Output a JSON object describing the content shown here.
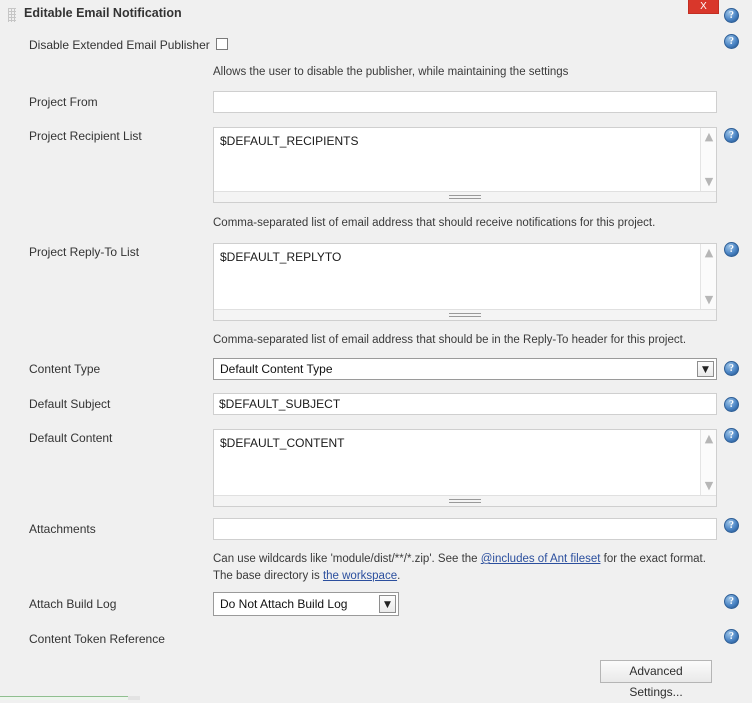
{
  "window": {
    "title": "Editable Email Notification",
    "close_label": "X",
    "drag_handle": "drag-grip"
  },
  "help_icon_glyph": "?",
  "fields": {
    "disable_publisher": {
      "label": "Disable Extended Email Publisher",
      "checked": false,
      "hint": "Allows the user to disable the publisher, while maintaining the settings"
    },
    "project_from": {
      "label": "Project From",
      "value": ""
    },
    "project_recipient_list": {
      "label": "Project Recipient List",
      "value": "$DEFAULT_RECIPIENTS",
      "hint": "Comma-separated list of email address that should receive notifications for this project."
    },
    "project_reply_to_list": {
      "label": "Project Reply-To List",
      "value": "$DEFAULT_REPLYTO",
      "hint": "Comma-separated list of email address that should be in the Reply-To header for this project."
    },
    "content_type": {
      "label": "Content Type",
      "value": "Default Content Type",
      "options": [
        "Default Content Type"
      ]
    },
    "default_subject": {
      "label": "Default Subject",
      "value": "$DEFAULT_SUBJECT"
    },
    "default_content": {
      "label": "Default Content",
      "value": "$DEFAULT_CONTENT"
    },
    "attachments": {
      "label": "Attachments",
      "value": "",
      "hint_line1_pre": "Can use wildcards like 'module/dist/**/*.zip'. See the ",
      "hint_link1": "@includes of Ant fileset",
      "hint_line1_post": " for the exact format.",
      "hint_line2_pre": "The base directory is ",
      "hint_link2": "the workspace",
      "hint_line2_post": "."
    },
    "attach_build_log": {
      "label": "Attach Build Log",
      "value": "Do Not Attach Build Log",
      "options": [
        "Do Not Attach Build Log"
      ]
    },
    "content_token_reference": {
      "label": "Content Token Reference"
    }
  },
  "buttons": {
    "advanced_settings": "Advanced Settings..."
  },
  "colors": {
    "close_red": "#d9372b",
    "help_blue": "#4a84c4",
    "link_blue": "#2b4f9e",
    "page_bg": "#f0f0f0",
    "accent_green": "#8fbf8f"
  }
}
